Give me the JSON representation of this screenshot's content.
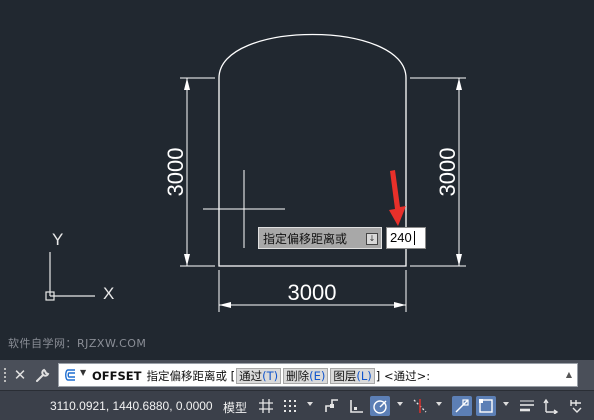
{
  "drawing": {
    "dim_left": "3000",
    "dim_right": "3000",
    "dim_bottom": "3000",
    "axis_y": "Y",
    "axis_x": "X"
  },
  "dynamic_input": {
    "prompt": "指定偏移距离或",
    "value": "240"
  },
  "watermark": "软件自学网：RJZXW.COM",
  "command_line": {
    "command": "OFFSET",
    "prompt": "指定偏移距离或",
    "bracket_open": "[",
    "bracket_close": "]",
    "options": [
      {
        "label": "通过",
        "key": "(T)"
      },
      {
        "label": "删除",
        "key": "(E)"
      },
      {
        "label": "图层",
        "key": "(L)"
      }
    ],
    "default": "<通过>:"
  },
  "status_bar": {
    "coordinates": "3110.0921, 1440.6880, 0.0000",
    "model_tab": "模型"
  },
  "colors": {
    "canvas_bg": "#212830",
    "arrow": "#e8302a",
    "active_toggle": "#5c7fb5"
  }
}
